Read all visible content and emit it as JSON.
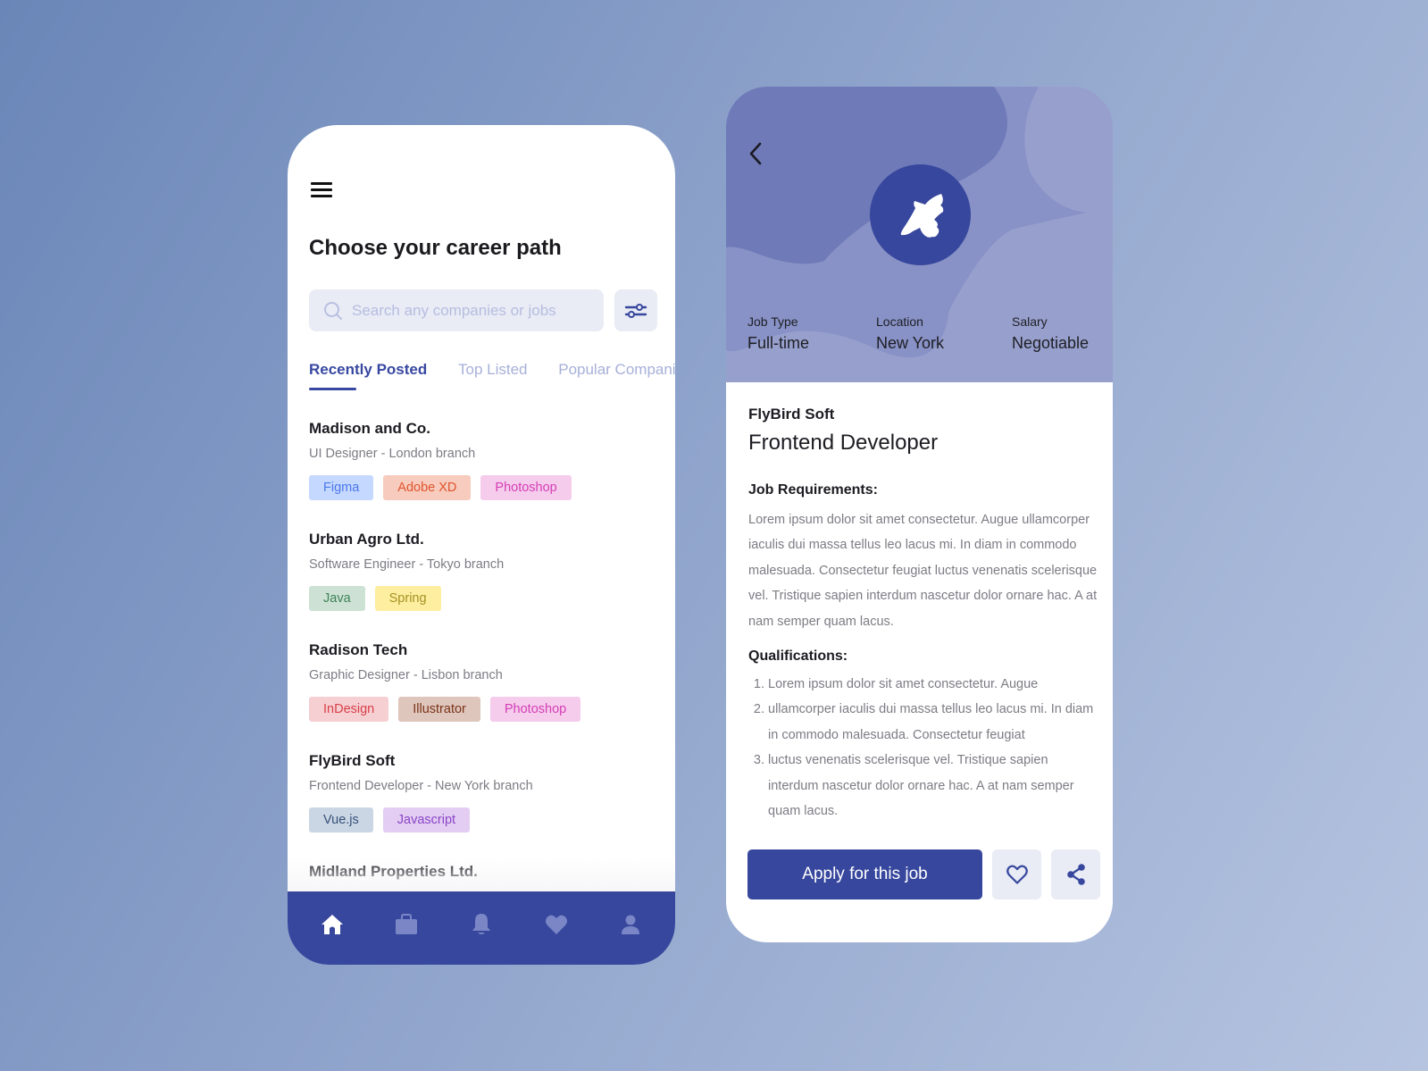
{
  "colors": {
    "primary": "#37479d",
    "muted_tab": "#a7b0d8",
    "search_bg": "#e9ebf5",
    "hero_bg": "#97a0cd"
  },
  "list_screen": {
    "menu_icon": "hamburger-menu-icon",
    "title": "Choose your career path",
    "search": {
      "placeholder": "Search any companies or jobs",
      "value": "",
      "icon": "search-icon"
    },
    "filter_icon": "sliders-icon",
    "tabs": [
      {
        "label": "Recently Posted",
        "active": true
      },
      {
        "label": "Top Listed",
        "active": false
      },
      {
        "label": "Popular Companies",
        "active": false
      }
    ],
    "jobs": [
      {
        "company": "Madison and Co.",
        "role": "UI Designer - London branch",
        "tags": [
          {
            "label": "Figma",
            "bg": "#c5d8ff",
            "fg": "#4a78e8"
          },
          {
            "label": "Adobe XD",
            "bg": "#f7cbbd",
            "fg": "#e0552e"
          },
          {
            "label": "Photoshop",
            "bg": "#f5ccec",
            "fg": "#d53fb6"
          }
        ]
      },
      {
        "company": "Urban Agro Ltd.",
        "role": "Software Engineer - Tokyo branch",
        "tags": [
          {
            "label": "Java",
            "bg": "#cde2d5",
            "fg": "#3f8358"
          },
          {
            "label": "Spring",
            "bg": "#fdeea0",
            "fg": "#a79324"
          }
        ]
      },
      {
        "company": "Radison Tech",
        "role": "Graphic Designer - Lisbon branch",
        "tags": [
          {
            "label": "InDesign",
            "bg": "#f6cfd2",
            "fg": "#d7404a"
          },
          {
            "label": "Illustrator",
            "bg": "#dfc6bd",
            "fg": "#7a3418"
          },
          {
            "label": "Photoshop",
            "bg": "#f5ccec",
            "fg": "#d53fb6"
          }
        ]
      },
      {
        "company": "FlyBird Soft",
        "role": "Frontend Developer - New York branch",
        "tags": [
          {
            "label": "Vue.js",
            "bg": "#cad6e3",
            "fg": "#35507a"
          },
          {
            "label": "Javascript",
            "bg": "#e3cdf2",
            "fg": "#8a45c8"
          }
        ]
      },
      {
        "company": "Midland Properties Ltd.",
        "role": "",
        "tags": []
      }
    ],
    "bottom_nav": [
      {
        "icon": "home-icon",
        "active": true
      },
      {
        "icon": "briefcase-icon",
        "active": false
      },
      {
        "icon": "bell-icon",
        "active": false
      },
      {
        "icon": "heart-icon",
        "active": false
      },
      {
        "icon": "user-icon",
        "active": false
      }
    ]
  },
  "detail_screen": {
    "back_icon": "chevron-left-icon",
    "logo_icon": "bird-logo-icon",
    "meta": [
      {
        "label": "Job Type",
        "value": "Full-time"
      },
      {
        "label": "Location",
        "value": "New York"
      },
      {
        "label": "Salary",
        "value": "Negotiable"
      }
    ],
    "company": "FlyBird Soft",
    "title": "Frontend Developer",
    "requirements_heading": "Job Requirements:",
    "requirements_text": "Lorem ipsum dolor sit amet consectetur. Augue ullamcorper iaculis dui massa tellus leo lacus mi. In diam in commodo malesuada. Consectetur feugiat luctus venenatis scelerisque vel. Tristique sapien interdum nascetur dolor ornare hac. A at nam semper quam lacus.",
    "qualifications_heading": "Qualifications:",
    "qualifications": [
      "Lorem ipsum dolor sit amet consectetur. Augue",
      "ullamcorper iaculis dui massa tellus leo lacus mi. In diam in commodo malesuada. Consectetur feugiat",
      "luctus venenatis scelerisque vel. Tristique sapien interdum nascetur dolor ornare hac. A at nam semper quam lacus."
    ],
    "apply_label": "Apply for this job",
    "favorite_icon": "heart-outline-icon",
    "share_icon": "share-icon"
  }
}
